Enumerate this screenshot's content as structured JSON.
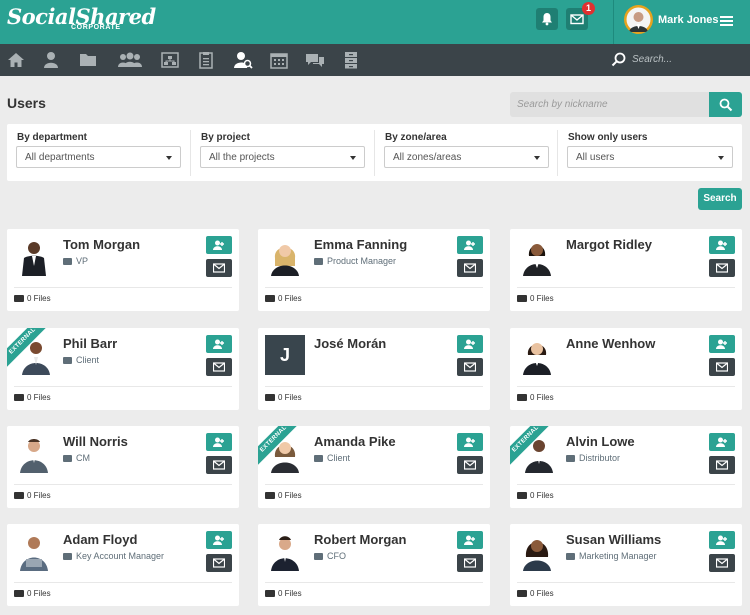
{
  "header": {
    "logo_main": "SocialShared",
    "logo_sub": "CORPORATE",
    "notification_count": "1",
    "user_name": "Mark Jones",
    "accent_color": "#2ba293",
    "nav_color": "#3b4449"
  },
  "nav": {
    "items": [
      "home-icon",
      "user-icon",
      "folder-icon",
      "group-icon",
      "org-chart-icon",
      "clipboard-icon",
      "user-search-icon",
      "calendar-icon",
      "chat-icon",
      "archive-icon"
    ],
    "search_placeholder": "Search..."
  },
  "page": {
    "title": "Users",
    "nickname_placeholder": "Search by nickname",
    "search_button": "Search"
  },
  "filters": [
    {
      "label": "By department",
      "value": "All departments"
    },
    {
      "label": "By project",
      "value": "All the projects"
    },
    {
      "label": "By zone/area",
      "value": "All zones/areas"
    },
    {
      "label": "Show only users",
      "value": "All users"
    }
  ],
  "users": [
    {
      "name": "Tom Morgan",
      "role": "VP",
      "external": false,
      "files": "0 Files",
      "initial": ""
    },
    {
      "name": "Emma Fanning",
      "role": "Product Manager",
      "external": false,
      "files": "0 Files",
      "initial": ""
    },
    {
      "name": "Margot Ridley",
      "role": "",
      "external": false,
      "files": "0 Files",
      "initial": ""
    },
    {
      "name": "Phil Barr",
      "role": "Client",
      "external": true,
      "files": "0 Files",
      "initial": ""
    },
    {
      "name": "José Morán",
      "role": "",
      "external": false,
      "files": "0 Files",
      "initial": "J"
    },
    {
      "name": "Anne Wenhow",
      "role": "",
      "external": false,
      "files": "0 Files",
      "initial": ""
    },
    {
      "name": "Will Norris",
      "role": "CM",
      "external": false,
      "files": "0 Files",
      "initial": ""
    },
    {
      "name": "Amanda Pike",
      "role": "Client",
      "external": true,
      "files": "0 Files",
      "initial": ""
    },
    {
      "name": "Alvin Lowe",
      "role": "Distributor",
      "external": true,
      "files": "0 Files",
      "initial": ""
    },
    {
      "name": "Adam Floyd",
      "role": "Key Account Manager",
      "external": false,
      "files": "0 Files",
      "initial": ""
    },
    {
      "name": "Robert Morgan",
      "role": "CFO",
      "external": false,
      "files": "0 Files",
      "initial": ""
    },
    {
      "name": "Susan Williams",
      "role": "Marketing Manager",
      "external": false,
      "files": "0 Files",
      "initial": ""
    }
  ],
  "labels": {
    "external": "EXTERNAL"
  }
}
